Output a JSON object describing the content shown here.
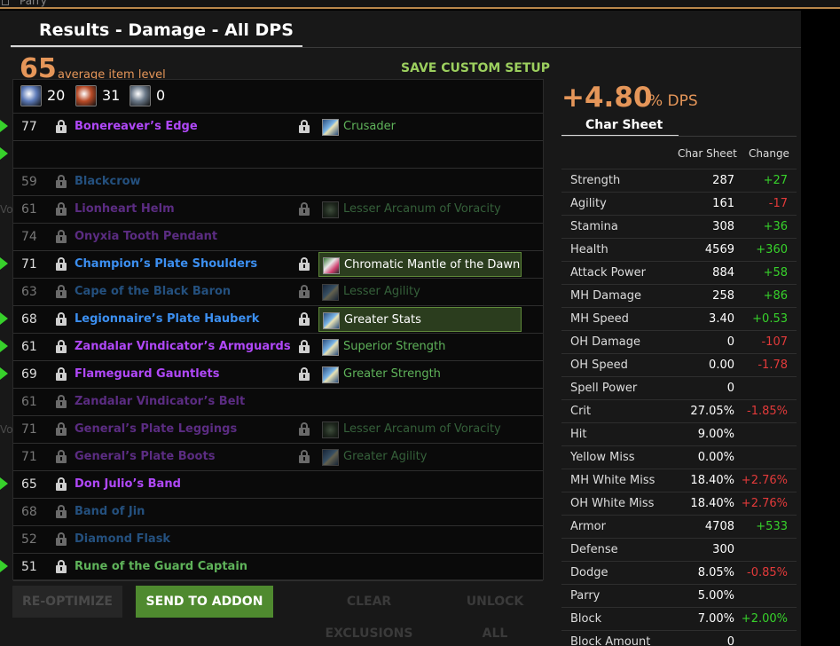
{
  "top": {
    "cut_label": "Parry"
  },
  "header": {
    "title": "Results - Damage - All DPS",
    "avg_level": "65",
    "avg_label": "average item level",
    "save_label": "SAVE CUSTOM SETUP"
  },
  "gems": [
    {
      "icon": "rune-icon",
      "count": "20",
      "color": "#5c7ab8"
    },
    {
      "icon": "fire-gem-icon",
      "count": "31",
      "color": "#b84a26"
    },
    {
      "icon": "shield-gem-icon",
      "count": "0",
      "color": "#6a7888"
    }
  ],
  "items": [
    {
      "ilvl": "77",
      "name": "Bonereaver’s Edge",
      "quality": "epic",
      "dim": false,
      "arrow": true,
      "lock_item": true,
      "enchant": "Crusader",
      "ench_icon": "normal",
      "lock_ench": true,
      "hl": false
    },
    {
      "ilvl": "",
      "name": "",
      "quality": "epic",
      "dim": false,
      "arrow": true,
      "lock_item": false,
      "enchant": "",
      "ench_icon": "",
      "lock_ench": false,
      "hl": false
    },
    {
      "ilvl": "59",
      "name": "Blackcrow",
      "quality": "rare",
      "dim": true,
      "arrow": false,
      "lock_item": true,
      "enchant": "",
      "ench_icon": "",
      "lock_ench": false,
      "hl": false
    },
    {
      "ilvl": "61",
      "name": "Lionheart Helm",
      "quality": "epic",
      "dim": true,
      "arrow": false,
      "lock_item": true,
      "enchant": "Lesser Arcanum of Voracity",
      "ench_icon": "arc",
      "lock_ench": true,
      "hl": false,
      "clip": "Vo"
    },
    {
      "ilvl": "74",
      "name": "Onyxia Tooth Pendant",
      "quality": "epic",
      "dim": true,
      "arrow": false,
      "lock_item": true,
      "enchant": "",
      "ench_icon": "",
      "lock_ench": false,
      "hl": false
    },
    {
      "ilvl": "71",
      "name": "Champion’s Plate Shoulders",
      "quality": "rare",
      "dim": false,
      "arrow": true,
      "lock_item": true,
      "enchant": "Chromatic Mantle of the Dawn",
      "ench_icon": "chrom",
      "lock_ench": true,
      "hl": true
    },
    {
      "ilvl": "63",
      "name": "Cape of the Black Baron",
      "quality": "rare",
      "dim": true,
      "arrow": false,
      "lock_item": true,
      "enchant": "Lesser Agility",
      "ench_icon": "normal",
      "lock_ench": true,
      "hl": false
    },
    {
      "ilvl": "68",
      "name": "Legionnaire’s Plate Hauberk",
      "quality": "rare",
      "dim": false,
      "arrow": true,
      "lock_item": true,
      "enchant": "Greater Stats",
      "ench_icon": "normal",
      "lock_ench": true,
      "hl": true
    },
    {
      "ilvl": "61",
      "name": "Zandalar Vindicator’s Armguards",
      "quality": "epic",
      "dim": false,
      "arrow": true,
      "lock_item": true,
      "enchant": "Superior Strength",
      "ench_icon": "normal",
      "lock_ench": true,
      "hl": false
    },
    {
      "ilvl": "69",
      "name": "Flameguard Gauntlets",
      "quality": "epic",
      "dim": false,
      "arrow": true,
      "lock_item": true,
      "enchant": "Greater Strength",
      "ench_icon": "normal",
      "lock_ench": true,
      "hl": false
    },
    {
      "ilvl": "61",
      "name": "Zandalar Vindicator’s Belt",
      "quality": "epic",
      "dim": true,
      "arrow": false,
      "lock_item": true,
      "enchant": "",
      "ench_icon": "",
      "lock_ench": false,
      "hl": false
    },
    {
      "ilvl": "71",
      "name": "General’s Plate Leggings",
      "quality": "epic",
      "dim": true,
      "arrow": false,
      "lock_item": true,
      "enchant": "Lesser Arcanum of Voracity",
      "ench_icon": "arc",
      "lock_ench": true,
      "hl": false,
      "clip": "Vo"
    },
    {
      "ilvl": "71",
      "name": "General’s Plate Boots",
      "quality": "epic",
      "dim": true,
      "arrow": false,
      "lock_item": true,
      "enchant": "Greater Agility",
      "ench_icon": "normal",
      "lock_ench": true,
      "hl": false
    },
    {
      "ilvl": "65",
      "name": "Don Julio’s Band",
      "quality": "epic",
      "dim": false,
      "arrow": true,
      "lock_item": true,
      "enchant": "",
      "ench_icon": "",
      "lock_ench": false,
      "hl": false
    },
    {
      "ilvl": "68",
      "name": "Band of Jin",
      "quality": "rare",
      "dim": true,
      "arrow": false,
      "lock_item": true,
      "enchant": "",
      "ench_icon": "",
      "lock_ench": false,
      "hl": false
    },
    {
      "ilvl": "52",
      "name": "Diamond Flask",
      "quality": "rare",
      "dim": true,
      "arrow": false,
      "lock_item": true,
      "enchant": "",
      "ench_icon": "",
      "lock_ench": false,
      "hl": false
    },
    {
      "ilvl": "51",
      "name": "Rune of the Guard Captain",
      "quality": "unc",
      "dim": false,
      "arrow": true,
      "lock_item": true,
      "enchant": "",
      "ench_icon": "",
      "lock_ench": false,
      "hl": false
    }
  ],
  "buttons": {
    "reoptimize": "RE-OPTIMIZE",
    "send": "SEND TO ADDON",
    "clear": "CLEAR EXCLUSIONS",
    "unlock": "UNLOCK ALL"
  },
  "dps": {
    "value": "+4.80",
    "unit": "% DPS"
  },
  "char_sheet": {
    "tab": "Char Sheet",
    "col_value": "Char Sheet",
    "col_change": "Change",
    "stats": [
      {
        "name": "Strength",
        "value": "287",
        "change": "+27",
        "dir": "pos"
      },
      {
        "name": "Agility",
        "value": "161",
        "change": "-17",
        "dir": "neg"
      },
      {
        "name": "Stamina",
        "value": "308",
        "change": "+36",
        "dir": "pos"
      },
      {
        "name": "Health",
        "value": "4569",
        "change": "+360",
        "dir": "pos"
      },
      {
        "name": "Attack Power",
        "value": "884",
        "change": "+58",
        "dir": "pos"
      },
      {
        "name": "MH Damage",
        "value": "258",
        "change": "+86",
        "dir": "pos"
      },
      {
        "name": "MH Speed",
        "value": "3.40",
        "change": "+0.53",
        "dir": "pos"
      },
      {
        "name": "OH Damage",
        "value": "0",
        "change": "-107",
        "dir": "neg"
      },
      {
        "name": "OH Speed",
        "value": "0.00",
        "change": "-1.78",
        "dir": "neg"
      },
      {
        "name": "Spell Power",
        "value": "0",
        "change": "",
        "dir": ""
      },
      {
        "name": "Crit",
        "value": "27.05%",
        "change": "-1.85%",
        "dir": "neg"
      },
      {
        "name": "Hit",
        "value": "9.00%",
        "change": "",
        "dir": ""
      },
      {
        "name": "Yellow Miss",
        "value": "0.00%",
        "change": "",
        "dir": ""
      },
      {
        "name": "MH White Miss",
        "value": "18.40%",
        "change": "+2.76%",
        "dir": "neg"
      },
      {
        "name": "OH White Miss",
        "value": "18.40%",
        "change": "+2.76%",
        "dir": "neg"
      },
      {
        "name": "Armor",
        "value": "4708",
        "change": "+533",
        "dir": "pos"
      },
      {
        "name": "Defense",
        "value": "300",
        "change": "",
        "dir": ""
      },
      {
        "name": "Dodge",
        "value": "8.05%",
        "change": "-0.85%",
        "dir": "neg"
      },
      {
        "name": "Parry",
        "value": "5.00%",
        "change": "",
        "dir": ""
      },
      {
        "name": "Block",
        "value": "7.00%",
        "change": "+2.00%",
        "dir": "pos"
      },
      {
        "name": "Block Amount",
        "value": "0",
        "change": "",
        "dir": ""
      }
    ]
  },
  "colors": {
    "accent_orange": "#e59659",
    "positive": "#37d12b",
    "negative": "#e23a3a",
    "epic": "#b048f8",
    "rare": "#3c8ff0",
    "uncommon": "#5fb35a",
    "send_button": "#4f8a2f"
  }
}
